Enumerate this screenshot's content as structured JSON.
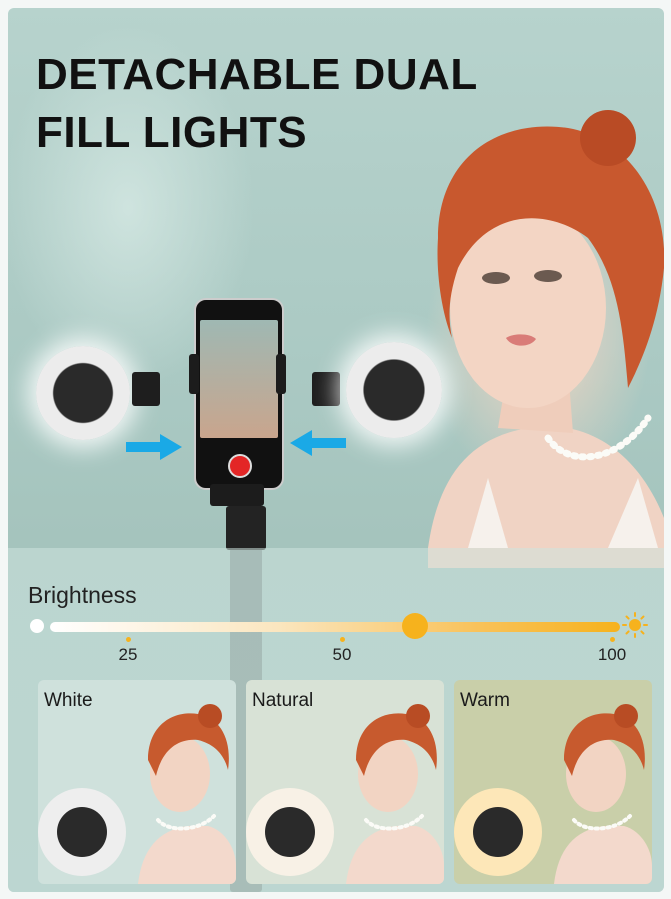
{
  "headline": {
    "line1": "DETACHABLE DUAL",
    "line2": "FILL LIGHTS"
  },
  "brightness": {
    "title": "Brightness",
    "level_percent": 65,
    "ticks": [
      {
        "label": "25",
        "value": 25
      },
      {
        "label": "50",
        "value": 50
      },
      {
        "label": "100",
        "value": 100
      }
    ],
    "colors": {
      "start": "#ffffff",
      "end": "#f6b21d"
    }
  },
  "modes": [
    {
      "label": "White",
      "ring_color": "#eeeeee",
      "tint": "#cfe1dc"
    },
    {
      "label": "Natural",
      "ring_color": "#f8f1e6",
      "tint": "#d8e2d6"
    },
    {
      "label": "Warm",
      "ring_color": "#fde7b8",
      "tint": "#c9cfa9"
    }
  ],
  "icons": {
    "arrow_color": "#1aa9e6",
    "sun_icon": "sun-icon",
    "record_button": "record-button-icon"
  }
}
